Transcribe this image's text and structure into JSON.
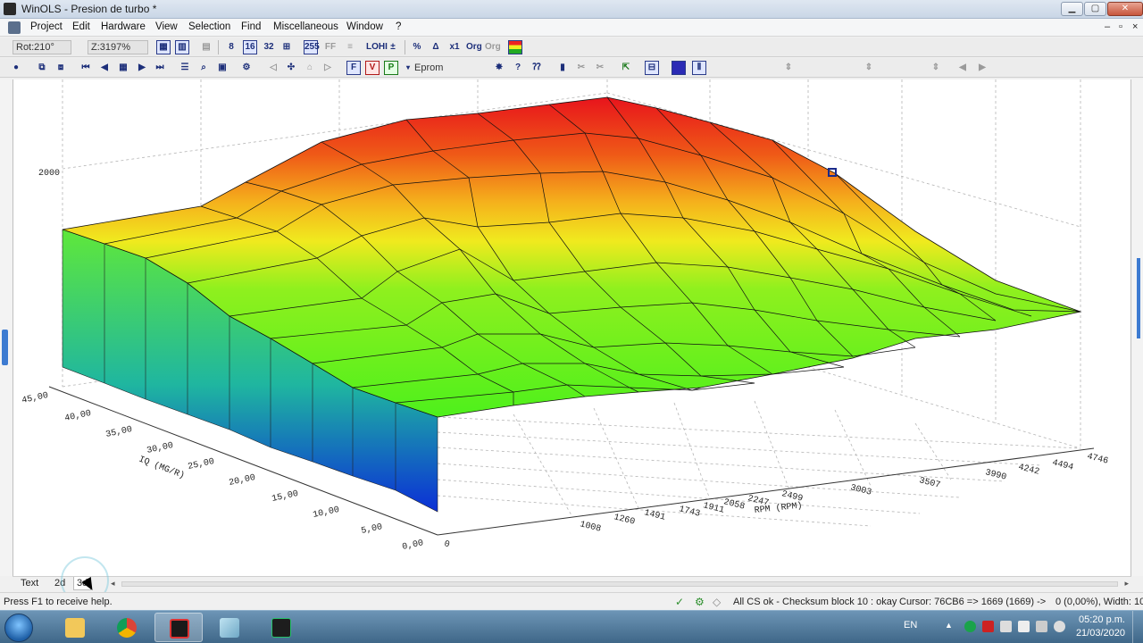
{
  "window": {
    "title": "WinOLS - Presion de turbo *",
    "minimize_glyph": "▁",
    "maximize_glyph": "▢",
    "close_glyph": "✕"
  },
  "menu": {
    "items": [
      "Project",
      "Edit",
      "Hardware",
      "View",
      "Selection",
      "Find",
      "Miscellaneous",
      "Window",
      "?"
    ],
    "mdi_min": "–",
    "mdi_restore": "▫",
    "mdi_close": "×"
  },
  "toolbar1": {
    "rotation_value": "Rot:210°",
    "zoom_value": "Z:3197%",
    "buttons": [
      "8",
      "16",
      "32",
      "255",
      "FF",
      "LOHI",
      "%",
      "Δ",
      "x1",
      "Org",
      "Org"
    ]
  },
  "toolbar2": {
    "dropdown_value": "Eprom"
  },
  "plot": {
    "z_tick_label": "2000",
    "y_axis_label": "IQ (MG/R)",
    "y_ticks": [
      "45,00",
      "40,00",
      "35,00",
      "30,00",
      "25,00",
      "20,00",
      "15,00",
      "10,00",
      "5,00",
      "0,00"
    ],
    "x_axis_label": "RPM (RPM)",
    "x_ticks": [
      "0",
      "1008",
      "1260",
      "1491",
      "1743",
      "1911",
      "2058",
      "2247",
      "2499",
      "3003",
      "3507",
      "3990",
      "4242",
      "4494",
      "4746"
    ],
    "surface_colors": {
      "peak": "#e8141c",
      "high": "#f59a1a",
      "mid": "#f0ea1e",
      "low": "#4ef01c",
      "wall_top": "#5fe83a",
      "wall_bottom": "#0b2fd6"
    }
  },
  "view_tabs": [
    "Text",
    "2d",
    "3d"
  ],
  "status": {
    "help": "Press F1 to receive help.",
    "checksum": "All CS ok - Checksum block 10 : okay",
    "cursor": "Cursor: 76CB6 => 1669 (1669) ->",
    "selection": "0 (0,00%), Width: 10"
  },
  "taskbar": {
    "language": "EN",
    "time": "05:20 p.m.",
    "date": "21/03/2020"
  }
}
